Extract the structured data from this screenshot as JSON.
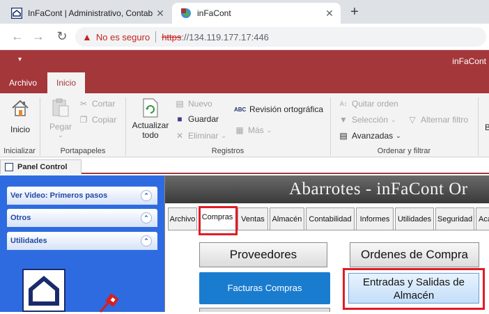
{
  "browser": {
    "tabs": [
      {
        "title": "InFaCont | Administrativo, Contab",
        "favicon": "infacont-icon"
      },
      {
        "title": "inFaCont",
        "favicon": "access-globe-icon"
      }
    ],
    "close_glyph": "✕",
    "new_tab_glyph": "+",
    "nav": {
      "back_glyph": "←",
      "forward_glyph": "→",
      "reload_glyph": "↻"
    },
    "security_label": "No es seguro",
    "url_protocol": "https",
    "url_rest": "://134.119.177.17:446"
  },
  "titlebar": {
    "qat_glyph": "▾",
    "app_title": "inFaCont"
  },
  "ribbon": {
    "tabs": [
      "Archivo",
      "Inicio"
    ],
    "groups": {
      "inicializar": {
        "label": "Inicializar",
        "button": "Inicio"
      },
      "portapapeles": {
        "label": "Portapapeles",
        "pegar": "Pegar",
        "cortar": "Cortar",
        "copiar": "Copiar"
      },
      "registros": {
        "label": "Registros",
        "actualizar_line1": "Actualizar",
        "actualizar_line2": "todo",
        "nuevo": "Nuevo",
        "guardar": "Guardar",
        "eliminar": "Eliminar",
        "revision": "Revisión ortográfica",
        "mas": "Más"
      },
      "ordenar": {
        "label": "Ordenar y filtrar",
        "quitar": "Quitar orden",
        "seleccion": "Selección",
        "avanzadas": "Avanzadas",
        "alternar": "Alternar filtro"
      }
    },
    "truncated_button": "B"
  },
  "panel_tab": "Panel Control",
  "left_panel": {
    "headers": [
      "Ver Video: Primeros pasos",
      "Otros",
      "Utilidades"
    ],
    "chevron_glyph": "⌃"
  },
  "main": {
    "banner_title": "Abarrotes - inFaCont Or",
    "tabs": [
      "Archivo",
      "Compras",
      "Ventas",
      "Almacén",
      "Contabilidad",
      "Informes",
      "Utilidades",
      "Seguridad",
      "Aca"
    ],
    "active_tab": "Compras",
    "buttons": {
      "proveedores": "Proveedores",
      "ordenes": "Ordenes de Compra",
      "facturas": "Facturas Compras",
      "entradas_line1": "Entradas y Salidas de",
      "entradas_line2": "Almacén"
    }
  },
  "colors": {
    "access_accent": "#a4373a",
    "panel_blue": "#2e6be0",
    "highlight_red": "#e01b24",
    "button_blue": "#1a7ccf"
  }
}
